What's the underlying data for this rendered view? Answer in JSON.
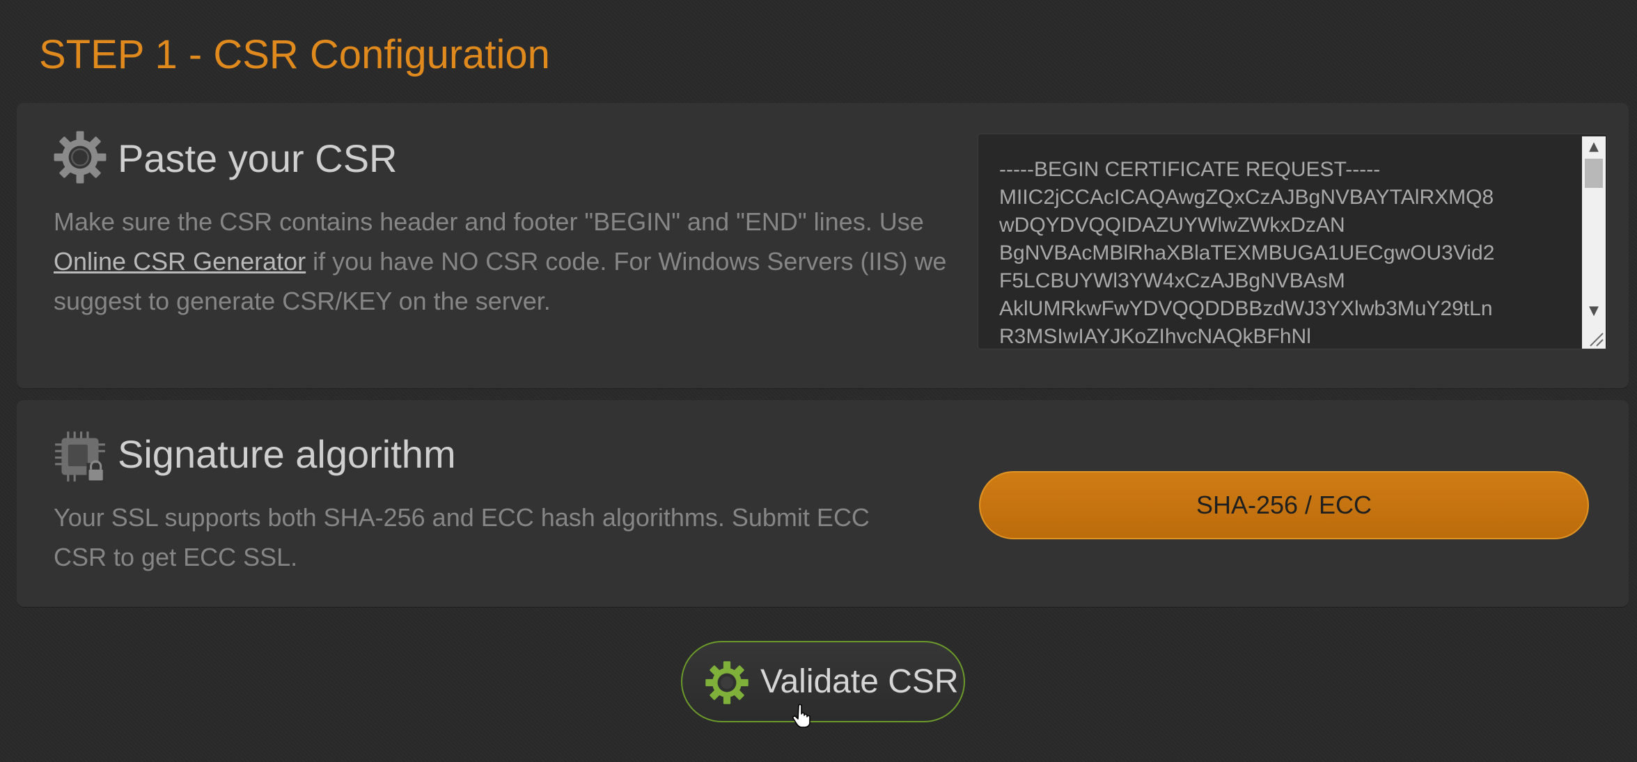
{
  "page": {
    "title": "STEP 1 - CSR Configuration"
  },
  "csr_section": {
    "icon": "gear-icon",
    "title": "Paste your CSR",
    "desc_line1": "Make sure the CSR contains header and footer \"BEGIN\" and \"END\" lines. Use ",
    "link_text": "Online CSR Generator",
    "desc_line2": " if you have NO CSR code. For Windows Servers (IIS) we suggest to generate CSR/KEY on the server.",
    "csr_value": "-----BEGIN CERTIFICATE REQUEST-----\nMIIC2jCCAcICAQAwgZQxCzAJBgNVBAYTAlRXMQ8\nwDQYDVQQIDAZUYWlwZWkxDzAN\nBgNVBAcMBlRhaXBlaTEXMBUGA1UECgwOU3Vid2\nF5LCBUYWl3YW4xCzAJBgNVBAsM\nAklUMRkwFwYDVQQDDBBzdWJ3YXlwb3MuY29tLn\nR3MSIwIAYJKoZIhvcNAQkBFhNl"
  },
  "signature_section": {
    "icon": "chip-lock-icon",
    "title": "Signature algorithm",
    "desc": "Your SSL supports both SHA-256 and ECC hash algorithms. Submit ECC CSR to get ECC SSL.",
    "button_label": "SHA-256 / ECC"
  },
  "actions": {
    "validate_icon": "gear-icon",
    "validate_label": "Validate CSR"
  },
  "colors": {
    "accent_orange": "#e08a1e",
    "button_orange": "#c97612",
    "validate_green": "#7fb03a",
    "background": "#2a2a2a",
    "panel": "#333333"
  }
}
